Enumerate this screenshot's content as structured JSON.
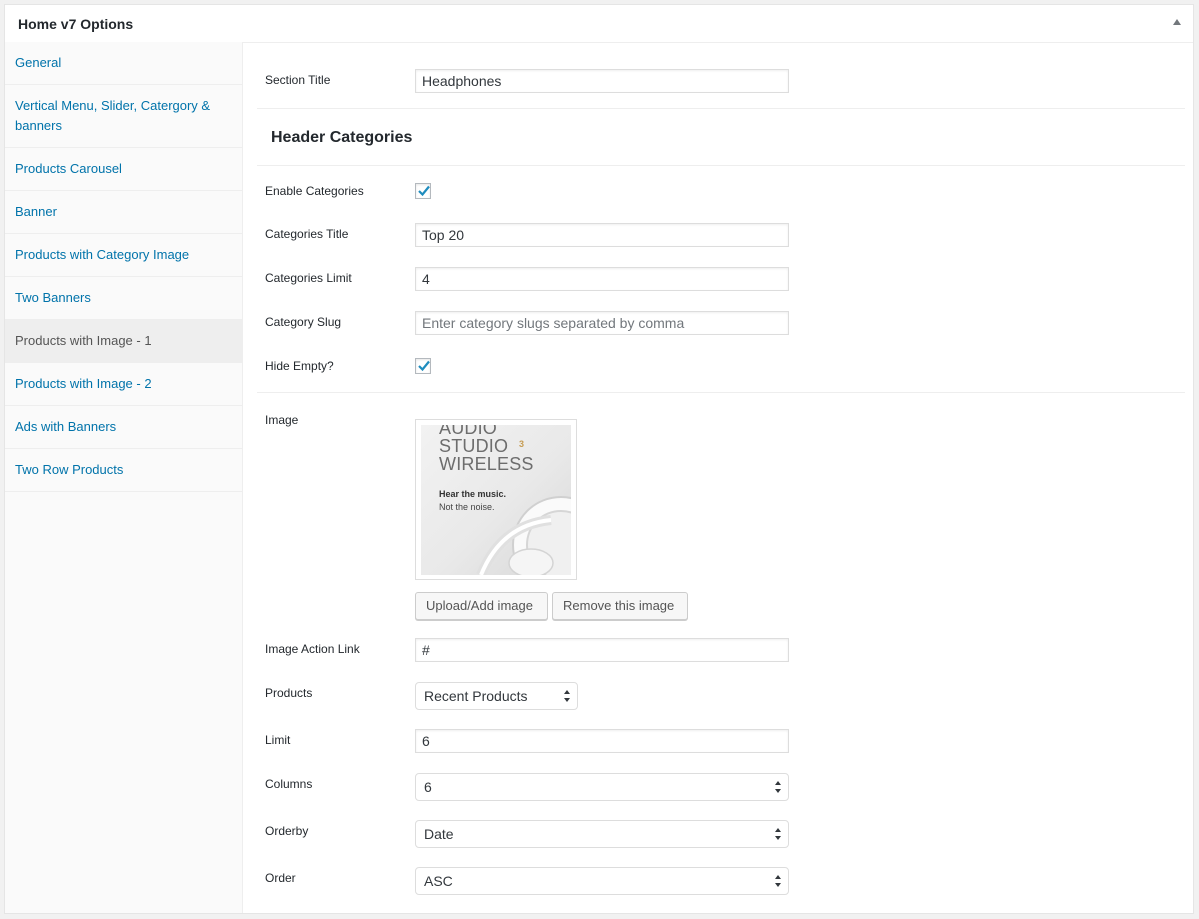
{
  "postbox": {
    "title": "Home v7 Options",
    "toggle_icon": "arrow-up-icon"
  },
  "sidebar": {
    "items": [
      {
        "label": "General"
      },
      {
        "label": "Vertical Menu, Slider, Catergory & banners"
      },
      {
        "label": "Products Carousel"
      },
      {
        "label": "Banner"
      },
      {
        "label": "Products with Category Image"
      },
      {
        "label": "Two Banners"
      },
      {
        "label": "Products with Image - 1"
      },
      {
        "label": "Products with Image - 2"
      },
      {
        "label": "Ads with Banners"
      },
      {
        "label": "Two Row Products"
      }
    ],
    "active_index": 6
  },
  "form": {
    "section_title": {
      "label": "Section Title",
      "value": "Headphones"
    },
    "header_categories_heading": "Header Categories",
    "enable_categories": {
      "label": "Enable Categories",
      "checked": true
    },
    "categories_title": {
      "label": "Categories Title",
      "value": "Top 20"
    },
    "categories_limit": {
      "label": "Categories Limit",
      "value": "4"
    },
    "category_slug": {
      "label": "Category Slug",
      "value": "",
      "placeholder": "Enter category slugs separated by comma"
    },
    "hide_empty": {
      "label": "Hide Empty?",
      "checked": true
    },
    "image": {
      "label": "Image",
      "preview_title_line1": "AUDIO",
      "preview_title_line2": "STUDIO",
      "preview_title_line3": "WIRELESS",
      "preview_sup": "3",
      "preview_tagline1": "Hear the music.",
      "preview_tagline2": "Not the noise.",
      "upload_button": "Upload/Add image",
      "remove_button": "Remove this image"
    },
    "image_action_link": {
      "label": "Image Action Link",
      "value": "#"
    },
    "products": {
      "label": "Products",
      "selected": "Recent Products"
    },
    "limit": {
      "label": "Limit",
      "value": "6"
    },
    "columns": {
      "label": "Columns",
      "selected": "6"
    },
    "orderby": {
      "label": "Orderby",
      "selected": "Date"
    },
    "order": {
      "label": "Order",
      "selected": "ASC"
    }
  },
  "colors": {
    "link": "#0073aa",
    "checkmark": "#1e8cbe"
  }
}
